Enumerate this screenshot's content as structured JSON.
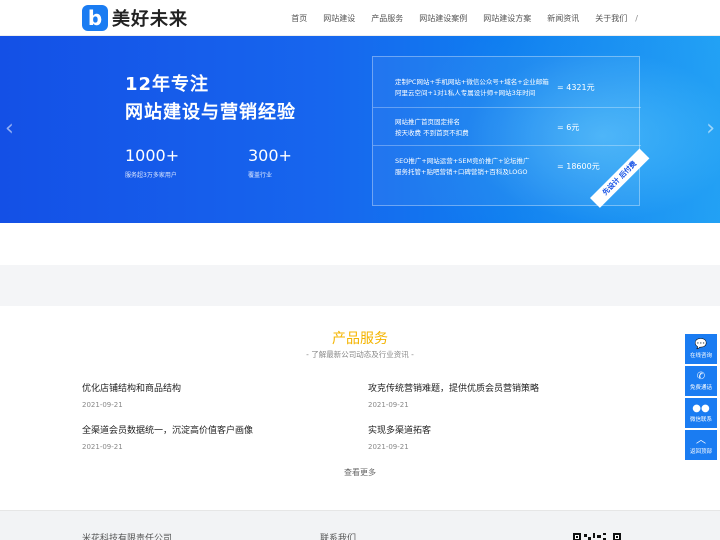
{
  "header": {
    "logo_mark": "b",
    "logo_text": "美好未来",
    "nav": [
      "首页",
      "网站建设",
      "产品服务",
      "网站建设案例",
      "网站建设方案",
      "新闻资讯",
      "关于我们"
    ],
    "nav_trailing": "/"
  },
  "banner": {
    "headline_1": "12年专注",
    "headline_2": "网站建设与营销经验",
    "stats": [
      {
        "number": "1000+",
        "label": "服务超3万多家用户"
      },
      {
        "number": "300+",
        "label": "覆盖行业"
      }
    ],
    "packages": [
      {
        "line_1": "定制PC网站+手机网站+微信公众号+域名+企业邮箱",
        "line_2": "阿里云空间+1对1私人专属设计师+网站3年时间",
        "price": "= 4321元"
      },
      {
        "line_1": "网站推广首页固定排名",
        "line_2": "按天收费 不到首页不扣费",
        "price": "= 6元"
      },
      {
        "line_1": "SEO推广+网站运营+SEM竞价推广+论坛推广",
        "line_2": "服务托管+贴吧营销+口碑营销+百科及LOGO",
        "price": "= 18600元"
      }
    ],
    "ribbon": "先设计 后付费"
  },
  "section": {
    "title": "产品服务",
    "subtitle": "- 了解最新公司动态及行业资讯 -",
    "news": [
      {
        "title": "优化店铺结构和商品结构",
        "date": "2021-09-21"
      },
      {
        "title": "攻克传统营销难题，提供优质会员营销策略",
        "date": "2021-09-21"
      },
      {
        "title": "全渠道会员数据统一，沉淀高价值客户画像",
        "date": "2021-09-21"
      },
      {
        "title": "实现多渠道拓客",
        "date": "2021-09-21"
      }
    ],
    "more": "查看更多"
  },
  "footer": {
    "company": "米花科技有限责任公司",
    "contact": "联系我们"
  },
  "float_bar": [
    {
      "icon": "chat-icon",
      "label": "在线咨询"
    },
    {
      "icon": "phone-icon",
      "label": "免费通话"
    },
    {
      "icon": "wechat-icon",
      "label": "微信联系"
    },
    {
      "icon": "arrow-up-icon",
      "label": "返回顶部"
    }
  ],
  "colors": {
    "brand": "#1a7cf2",
    "accent": "#f4b400"
  }
}
